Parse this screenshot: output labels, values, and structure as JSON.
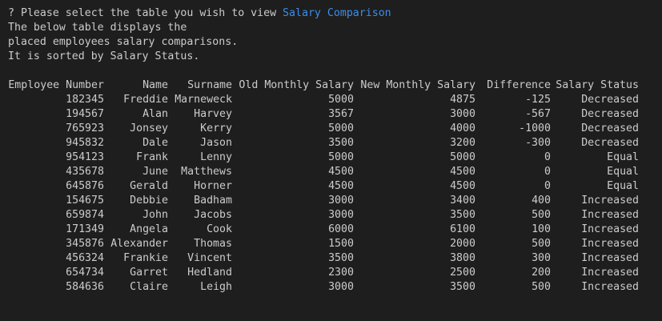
{
  "prompt": {
    "question_mark": "?",
    "question": "Please select the table you wish to view",
    "answer": "Salary Comparison"
  },
  "description": [
    "The below table displays the",
    "placed employees salary comparisons.",
    "It is sorted by Salary Status."
  ],
  "table": {
    "headers": [
      "Employee Number",
      "Name",
      "Surname",
      "Old Monthly Salary",
      "New Monthly Salary",
      "Difference",
      "Salary Status"
    ],
    "rows": [
      [
        "182345",
        "Freddie",
        "Marneweck",
        "5000",
        "4875",
        "-125",
        "Decreased"
      ],
      [
        "194567",
        "Alan",
        "Harvey",
        "3567",
        "3000",
        "-567",
        "Decreased"
      ],
      [
        "765923",
        "Jonsey",
        "Kerry",
        "5000",
        "4000",
        "-1000",
        "Decreased"
      ],
      [
        "945832",
        "Dale",
        "Jason",
        "3500",
        "3200",
        "-300",
        "Decreased"
      ],
      [
        "954123",
        "Frank",
        "Lenny",
        "5000",
        "5000",
        "0",
        "Equal"
      ],
      [
        "435678",
        "June",
        "Matthews",
        "4500",
        "4500",
        "0",
        "Equal"
      ],
      [
        "645876",
        "Gerald",
        "Horner",
        "4500",
        "4500",
        "0",
        "Equal"
      ],
      [
        "154675",
        "Debbie",
        "Badham",
        "3000",
        "3400",
        "400",
        "Increased"
      ],
      [
        "659874",
        "John",
        "Jacobs",
        "3000",
        "3500",
        "500",
        "Increased"
      ],
      [
        "171349",
        "Angela",
        "Cook",
        "6000",
        "6100",
        "100",
        "Increased"
      ],
      [
        "345876",
        "Alexander",
        "Thomas",
        "1500",
        "2000",
        "500",
        "Increased"
      ],
      [
        "456324",
        "Frankie",
        "Vincent",
        "3500",
        "3800",
        "300",
        "Increased"
      ],
      [
        "654734",
        "Garret",
        "Hedland",
        "2300",
        "2500",
        "200",
        "Increased"
      ],
      [
        "584636",
        "Claire",
        "Leigh",
        "3000",
        "3500",
        "500",
        "Increased"
      ]
    ]
  },
  "colors": {
    "background": "#1e1e1e",
    "text": "#cccccc",
    "answer": "#3b8eea"
  }
}
